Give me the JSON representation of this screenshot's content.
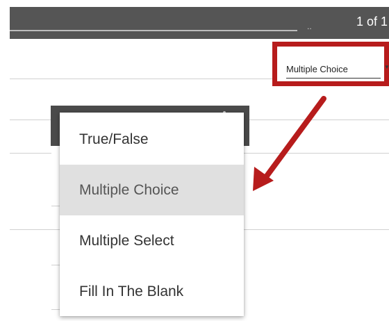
{
  "header": {
    "ellipsis": "..",
    "pager": "1 of 1"
  },
  "question_type_select": {
    "value": "Multiple Choice",
    "caret": "▼"
  },
  "dropdown": {
    "items": [
      {
        "label": "True/False",
        "selected": false
      },
      {
        "label": "Multiple Choice",
        "selected": true
      },
      {
        "label": "Multiple Select",
        "selected": false
      },
      {
        "label": "Fill In The Blank",
        "selected": false
      }
    ]
  },
  "colors": {
    "highlight": "#b71c1c",
    "topbar": "#555555",
    "selected_item": "#e0e0e0"
  }
}
